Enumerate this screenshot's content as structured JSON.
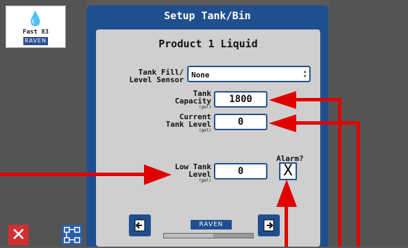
{
  "logo": {
    "product": "Fast 83",
    "brand": "RAVEN"
  },
  "dialog": {
    "title": "Setup Tank/Bin",
    "product": "Product 1 Liquid"
  },
  "fields": {
    "sensor_label_line1": "Tank Fill/",
    "sensor_label_line2": "Level Sensor",
    "sensor_value": "None",
    "capacity_label_line1": "Tank",
    "capacity_label_line2": "Capacity",
    "capacity_unit": "(gal)",
    "capacity_value": "1800",
    "current_label_line1": "Current",
    "current_label_line2": "Tank Level",
    "current_unit": "(gal)",
    "current_value": "0",
    "low_label_line1": "Low Tank",
    "low_label_line2": "Level",
    "low_unit": "(gal)",
    "low_value": "0",
    "alarm_label": "Alarm?",
    "alarm_mark": "X"
  },
  "footer": {
    "brand": "RAVEN",
    "progress": 0.55
  },
  "bottom": {
    "cancel_glyph": "✕"
  },
  "colors": {
    "dialog_blue": "#1f4f8f",
    "panel_gray": "#cfcfcf",
    "annotation_red": "#e00000",
    "cancel_red": "#d03030"
  },
  "icons": [
    "water-drop-icon",
    "up-down-spinner-icon",
    "previous-page-icon",
    "next-page-icon",
    "cancel-icon",
    "network-icon"
  ]
}
